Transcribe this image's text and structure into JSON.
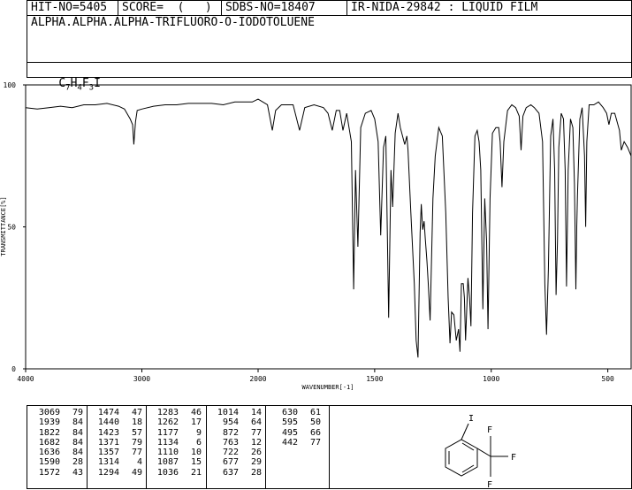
{
  "header": {
    "hit_no": "HIT-NO=5405",
    "score": "SCORE=  (   )",
    "sdbs_no": "SDBS-NO=18407",
    "method": "IR-NIDA-29842 : LIQUID FILM"
  },
  "compound_name": "ALPHA.ALPHA.ALPHA-TRIFLUORO-O-IODOTOLUENE",
  "formula": "C7H4F3I",
  "formula_parts": {
    "c": "C",
    "c_n": "7",
    "h": "H",
    "h_n": "4",
    "f": "F",
    "f_n": "3",
    "i": "I"
  },
  "chart_data": {
    "type": "line",
    "xlabel": "WAVENUMBER[-1]",
    "ylabel": "TRANSMITTANCE[%]",
    "xlim": [
      4000,
      400
    ],
    "ylim": [
      0,
      100
    ],
    "x_ticks": [
      "4000",
      "3000",
      "2000",
      "1500",
      "1000",
      "500"
    ],
    "y_ticks": [
      "0",
      "50",
      "100"
    ],
    "series": [
      {
        "points": [
          [
            4000,
            92
          ],
          [
            3900,
            91.5
          ],
          [
            3800,
            92
          ],
          [
            3700,
            92.5
          ],
          [
            3600,
            92
          ],
          [
            3500,
            93
          ],
          [
            3400,
            93
          ],
          [
            3300,
            93.5
          ],
          [
            3200,
            92.5
          ],
          [
            3150,
            91.5
          ],
          [
            3100,
            88
          ],
          [
            3080,
            86
          ],
          [
            3069,
            79
          ],
          [
            3055,
            87
          ],
          [
            3040,
            91
          ],
          [
            3000,
            91.5
          ],
          [
            2900,
            92.5
          ],
          [
            2800,
            93
          ],
          [
            2700,
            93
          ],
          [
            2600,
            93.5
          ],
          [
            2500,
            93.5
          ],
          [
            2400,
            93.5
          ],
          [
            2300,
            93
          ],
          [
            2200,
            94
          ],
          [
            2100,
            94
          ],
          [
            2050,
            94
          ],
          [
            2000,
            95
          ],
          [
            1960,
            93
          ],
          [
            1939,
            84
          ],
          [
            1925,
            91
          ],
          [
            1900,
            93
          ],
          [
            1850,
            93
          ],
          [
            1822,
            84
          ],
          [
            1800,
            92
          ],
          [
            1760,
            93
          ],
          [
            1720,
            92
          ],
          [
            1700,
            90
          ],
          [
            1682,
            84
          ],
          [
            1665,
            91
          ],
          [
            1650,
            91
          ],
          [
            1636,
            84
          ],
          [
            1620,
            90
          ],
          [
            1600,
            80
          ],
          [
            1590,
            28
          ],
          [
            1582,
            70
          ],
          [
            1572,
            43
          ],
          [
            1560,
            85
          ],
          [
            1540,
            90
          ],
          [
            1515,
            91
          ],
          [
            1500,
            88
          ],
          [
            1485,
            80
          ],
          [
            1474,
            47
          ],
          [
            1462,
            78
          ],
          [
            1452,
            82
          ],
          [
            1440,
            18
          ],
          [
            1430,
            70
          ],
          [
            1423,
            57
          ],
          [
            1412,
            83
          ],
          [
            1400,
            90
          ],
          [
            1390,
            85
          ],
          [
            1371,
            79
          ],
          [
            1362,
            82
          ],
          [
            1357,
            77
          ],
          [
            1345,
            55
          ],
          [
            1330,
            30
          ],
          [
            1322,
            10
          ],
          [
            1314,
            4
          ],
          [
            1305,
            48
          ],
          [
            1300,
            58
          ],
          [
            1294,
            49
          ],
          [
            1288,
            52
          ],
          [
            1283,
            46
          ],
          [
            1276,
            38
          ],
          [
            1270,
            30
          ],
          [
            1262,
            17
          ],
          [
            1250,
            60
          ],
          [
            1240,
            75
          ],
          [
            1225,
            85
          ],
          [
            1210,
            82
          ],
          [
            1195,
            55
          ],
          [
            1185,
            25
          ],
          [
            1177,
            9
          ],
          [
            1170,
            20
          ],
          [
            1160,
            19
          ],
          [
            1150,
            10
          ],
          [
            1140,
            14
          ],
          [
            1134,
            6
          ],
          [
            1128,
            30
          ],
          [
            1120,
            30
          ],
          [
            1115,
            25
          ],
          [
            1110,
            10
          ],
          [
            1100,
            32
          ],
          [
            1093,
            25
          ],
          [
            1087,
            15
          ],
          [
            1080,
            55
          ],
          [
            1070,
            82
          ],
          [
            1060,
            84
          ],
          [
            1052,
            80
          ],
          [
            1045,
            70
          ],
          [
            1036,
            21
          ],
          [
            1028,
            60
          ],
          [
            1020,
            45
          ],
          [
            1014,
            14
          ],
          [
            1005,
            60
          ],
          [
            995,
            83
          ],
          [
            980,
            85
          ],
          [
            968,
            85
          ],
          [
            962,
            80
          ],
          [
            954,
            64
          ],
          [
            946,
            80
          ],
          [
            930,
            91
          ],
          [
            912,
            93
          ],
          [
            895,
            92
          ],
          [
            880,
            89
          ],
          [
            872,
            77
          ],
          [
            864,
            89
          ],
          [
            850,
            92
          ],
          [
            830,
            93
          ],
          [
            815,
            92
          ],
          [
            795,
            90
          ],
          [
            780,
            80
          ],
          [
            770,
            30
          ],
          [
            763,
            12
          ],
          [
            755,
            35
          ],
          [
            745,
            82
          ],
          [
            735,
            88
          ],
          [
            728,
            70
          ],
          [
            722,
            26
          ],
          [
            716,
            45
          ],
          [
            710,
            78
          ],
          [
            700,
            90
          ],
          [
            690,
            88
          ],
          [
            683,
            70
          ],
          [
            677,
            29
          ],
          [
            670,
            70
          ],
          [
            660,
            88
          ],
          [
            650,
            85
          ],
          [
            643,
            65
          ],
          [
            637,
            28
          ],
          [
            633,
            50
          ],
          [
            630,
            61
          ],
          [
            620,
            88
          ],
          [
            610,
            92
          ],
          [
            600,
            75
          ],
          [
            595,
            50
          ],
          [
            590,
            80
          ],
          [
            580,
            93
          ],
          [
            560,
            93
          ],
          [
            540,
            94
          ],
          [
            520,
            92
          ],
          [
            505,
            90
          ],
          [
            495,
            86
          ],
          [
            485,
            90
          ],
          [
            470,
            90
          ],
          [
            450,
            84
          ],
          [
            442,
            77
          ],
          [
            430,
            80
          ],
          [
            415,
            78
          ],
          [
            400,
            75
          ]
        ]
      }
    ]
  },
  "peak_table": [
    [
      [
        "3069",
        "79"
      ],
      [
        "1939",
        "84"
      ],
      [
        "1822",
        "84"
      ],
      [
        "1682",
        "84"
      ],
      [
        "1636",
        "84"
      ],
      [
        "1590",
        "28"
      ],
      [
        "1572",
        "43"
      ]
    ],
    [
      [
        "1474",
        "47"
      ],
      [
        "1440",
        "18"
      ],
      [
        "1423",
        "57"
      ],
      [
        "1371",
        "79"
      ],
      [
        "1357",
        "77"
      ],
      [
        "1314",
        "4"
      ],
      [
        "1294",
        "49"
      ]
    ],
    [
      [
        "1283",
        "46"
      ],
      [
        "1262",
        "17"
      ],
      [
        "1177",
        "9"
      ],
      [
        "1134",
        "6"
      ],
      [
        "1110",
        "10"
      ],
      [
        "1087",
        "15"
      ],
      [
        "1036",
        "21"
      ]
    ],
    [
      [
        "1014",
        "14"
      ],
      [
        "954",
        "64"
      ],
      [
        "872",
        "77"
      ],
      [
        "763",
        "12"
      ],
      [
        "722",
        "26"
      ],
      [
        "677",
        "29"
      ],
      [
        "637",
        "28"
      ]
    ],
    [
      [
        "630",
        "61"
      ],
      [
        "595",
        "50"
      ],
      [
        "495",
        "66"
      ],
      [
        "442",
        "77"
      ]
    ]
  ],
  "structure": {
    "iodo_label": "I",
    "fluoro_labels": [
      "F",
      "F",
      "F"
    ]
  }
}
